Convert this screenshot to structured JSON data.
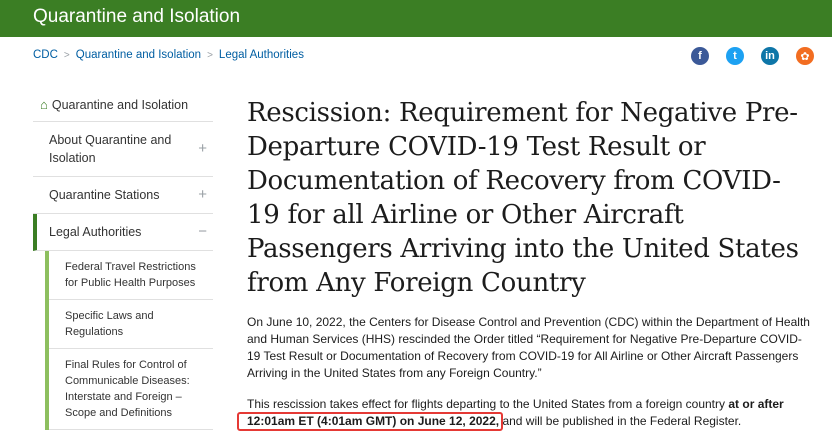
{
  "header": {
    "title": "Quarantine and Isolation"
  },
  "breadcrumb": [
    "CDC",
    "Quarantine and Isolation",
    "Legal Authorities"
  ],
  "breadcrumb_separator": ">",
  "social": [
    {
      "name": "facebook-icon",
      "glyph": "f"
    },
    {
      "name": "twitter-icon",
      "glyph": "t"
    },
    {
      "name": "linkedin-icon",
      "glyph": "in"
    },
    {
      "name": "syndicate-icon",
      "glyph": "✿"
    }
  ],
  "sidebar": {
    "home_label": "Quarantine and Isolation",
    "items": [
      {
        "label": "About Quarantine and Isolation",
        "toggle": "+"
      },
      {
        "label": "Quarantine Stations",
        "toggle": "+"
      },
      {
        "label": "Legal Authorities",
        "toggle": "−"
      }
    ],
    "subitems": [
      "Federal Travel Restrictions for Public Health Purposes",
      "Specific Laws and Regulations",
      "Final Rules for Control of Communicable Diseases: Interstate and Foreign – Scope and Definitions"
    ]
  },
  "main": {
    "title": "Rescission: Requirement for Negative Pre-Departure COVID-19 Test Result or Documentation of Recovery from COVID-19 for all Airline or Other Aircraft Passengers Arriving into the United States from Any Foreign Country",
    "para1": "On June 10, 2022, the Centers for Disease Control and Prevention (CDC) within the Department of Health and Human Services (HHS) rescinded the Order titled “Requirement for Negative Pre-Departure COVID-19 Test Result or Documentation of Recovery from COVID-19 for All Airline or Other Aircraft Passengers Arriving in the United States from any Foreign Country.”",
    "para2_start": "This rescission takes effect for flights departing to the United States from a foreign country ",
    "para2_bold": "at or after",
    "para2_highlight": "12:01am ET (4:01am GMT) on June 12, 2022,",
    "para2_end": " and will be published in the Federal Register."
  },
  "colors": {
    "brand_green": "#3b7e24",
    "link_blue": "#005ea2",
    "highlight_red": "#e53935"
  }
}
